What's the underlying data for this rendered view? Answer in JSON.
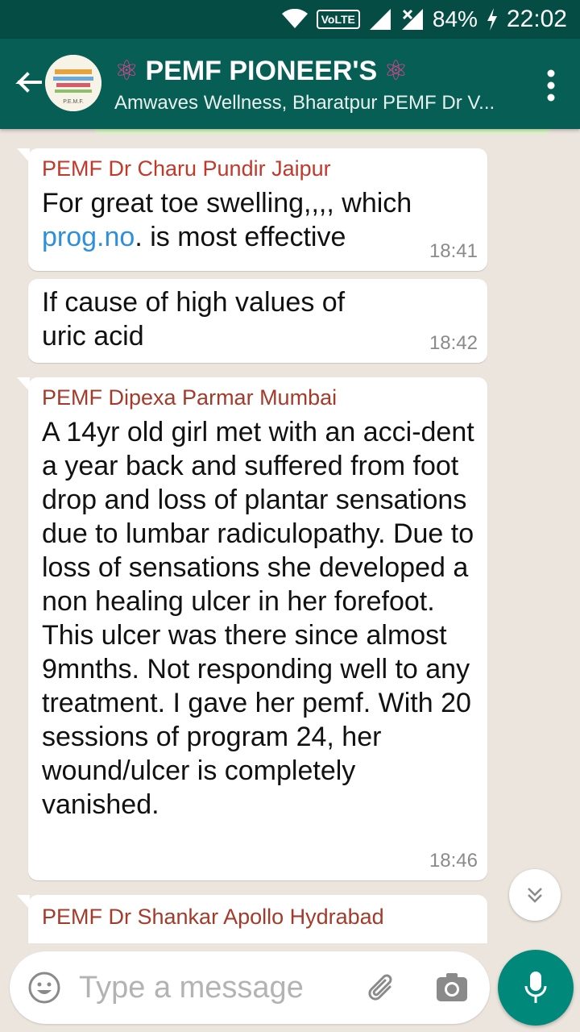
{
  "status_bar": {
    "network": "VoLTE",
    "battery": "84%",
    "time": "22:02"
  },
  "header": {
    "title": "PEMF PIONEER'S",
    "title_emoji": "⚛",
    "subtitle": "Amwaves Wellness, Bharatpur PEMF Dr V...",
    "avatar_text": "P.E.M.F."
  },
  "messages": [
    {
      "sender": "PEMF Dr Charu Pundir Jaipur",
      "text_before_link": "For great toe swelling,,,, which ",
      "link": "prog.no",
      "text_after_link": ". is most effective",
      "time": "18:41"
    },
    {
      "text": "If cause of high values of uric acid",
      "time": "18:42"
    },
    {
      "sender": "PEMF Dipexa Parmar Mumbai",
      "text": "A 14yr old girl met with an acci-dent a year back and suffered from foot drop and loss of plantar sensations due to lumbar radiculopathy. Due to loss of sensations she developed a non healing ulcer in her forefoot. This ulcer was there since almost 9mnths. Not responding well to any treatment.  I gave her pemf. With 20 sessions of program 24, her wound/ulcer is completely vanished.",
      "time": "18:46"
    },
    {
      "sender": "PEMF Dr Shankar Apollo Hydrabad"
    }
  ],
  "composer": {
    "placeholder": "Type a message"
  },
  "colors": {
    "header": "#075e54",
    "status": "#054d44",
    "accent": "#00897b",
    "bubble": "#ffffff",
    "link": "#2f8fd8"
  }
}
